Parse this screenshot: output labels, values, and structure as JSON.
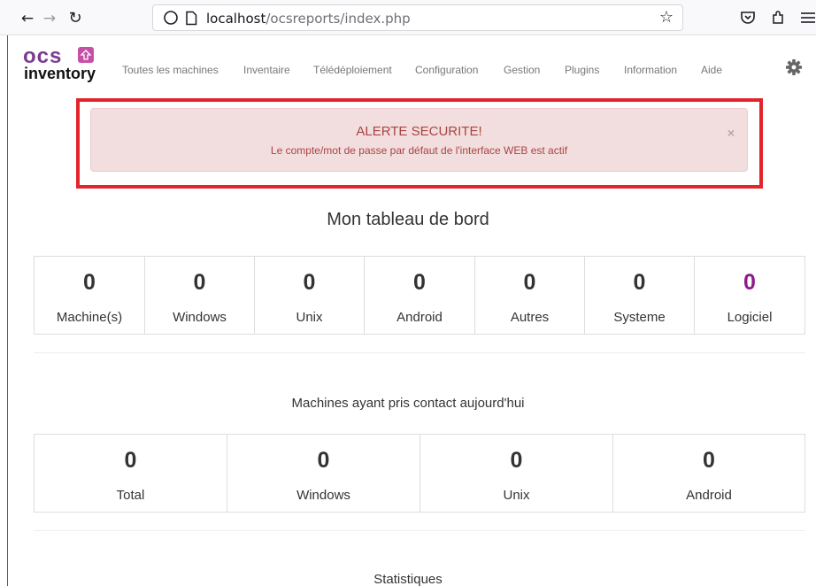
{
  "browser": {
    "url_host": "localhost",
    "url_path": "/ocsreports/index.php",
    "icons": [
      "back-arrow-icon",
      "forward-arrow-icon",
      "reload-icon",
      "shield-icon",
      "page-icon",
      "bookmark-star-icon",
      "pocket-icon",
      "extensions-icon",
      "hamburger-menu-icon"
    ]
  },
  "app": {
    "logo_top": "ocs",
    "logo_bottom": "inventory",
    "menu": [
      "Toutes les machines",
      "Inventaire",
      "Télédéploiement",
      "Configuration",
      "Gestion",
      "Plugins",
      "Information",
      "Aide"
    ]
  },
  "alert": {
    "title": "ALERTE SECURITE!",
    "message": "Le compte/mot de passe par défaut de l'interface WEB est actif",
    "close": "×",
    "color": "#a94442",
    "background": "#f2dede",
    "frame_color": "#e3242b"
  },
  "dashboard": {
    "title": "Mon tableau de bord",
    "machines": [
      {
        "value": "0",
        "label": "Machine(s)"
      },
      {
        "value": "0",
        "label": "Windows"
      },
      {
        "value": "0",
        "label": "Unix"
      },
      {
        "value": "0",
        "label": "Android"
      },
      {
        "value": "0",
        "label": "Autres"
      },
      {
        "value": "0",
        "label": "Systeme"
      },
      {
        "value": "0",
        "label": "Logiciel"
      }
    ],
    "contact_title": "Machines ayant pris contact aujourd'hui",
    "contact": [
      {
        "value": "0",
        "label": "Total"
      },
      {
        "value": "0",
        "label": "Windows"
      },
      {
        "value": "0",
        "label": "Unix"
      },
      {
        "value": "0",
        "label": "Android"
      }
    ],
    "stats_title": "Statistiques",
    "accent_color": "#8e1a8a"
  }
}
